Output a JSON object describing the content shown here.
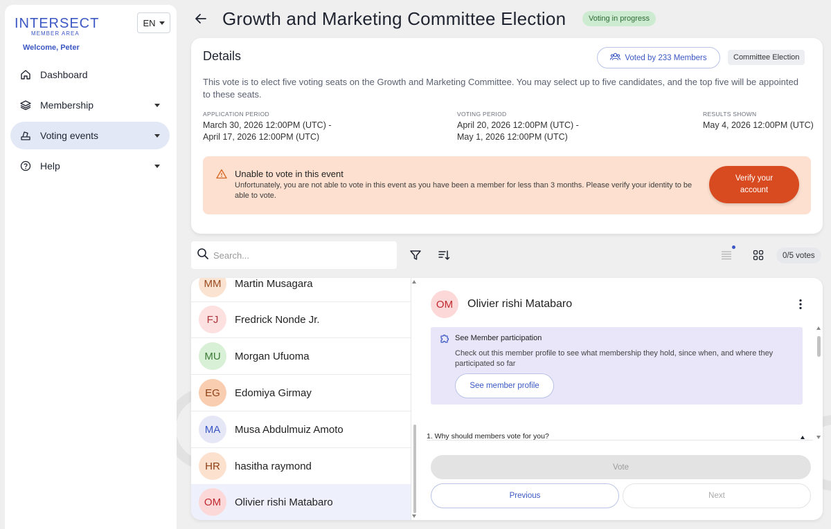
{
  "sidebar": {
    "logo_main": "INTERSECT",
    "logo_sub": "MEMBER AREA",
    "language": "EN",
    "welcome": "Welcome, Peter",
    "items": [
      {
        "label": "Dashboard",
        "icon": "home-icon"
      },
      {
        "label": "Membership",
        "icon": "layers-icon"
      },
      {
        "label": "Voting events",
        "icon": "ballot-icon",
        "active": true
      },
      {
        "label": "Help",
        "icon": "help-icon"
      }
    ]
  },
  "header": {
    "title": "Growth and Marketing Committee Election",
    "status": "Voting in progress"
  },
  "details": {
    "heading": "Details",
    "voted_by": "Voted by 233 Members",
    "type": "Committee Election",
    "description": "This vote is to elect five voting seats on the Growth and Marketing Committee. You may select up to five candidates, and the top five will be appointed to these seats.",
    "application": {
      "label": "APPLICATION PERIOD",
      "line1": "March 30, 2026 12:00PM (UTC) -",
      "line2": "April 17, 2026 12:00PM (UTC)"
    },
    "voting": {
      "label": "VOTING PERIOD",
      "line1": "April 20, 2026 12:00PM (UTC) -",
      "line2": "May 1, 2026 12:00PM (UTC)"
    },
    "results": {
      "label": "RESULTS SHOWN",
      "line1": "May 4, 2026 12:00PM (UTC)"
    },
    "alert": {
      "title": "Unable to vote in this event",
      "body": "Unfortunately, you are not able to vote in this event as you have been a member for less than 3 months. Please verify your identity to be able to vote.",
      "button_line1": "Verify your",
      "button_line2": "account"
    }
  },
  "toolbar": {
    "search_placeholder": "Search...",
    "votes": "0/5 votes"
  },
  "candidates": [
    {
      "initials": "MM",
      "name": "Martin Musagara",
      "bg": "#fbe3d2",
      "fg": "#9a4a1f"
    },
    {
      "initials": "FJ",
      "name": "Fredrick Nonde Jr.",
      "bg": "#fde0e0",
      "fg": "#b0333a"
    },
    {
      "initials": "MU",
      "name": "Morgan Ufuoma",
      "bg": "#d8f0d5",
      "fg": "#3d7a36"
    },
    {
      "initials": "EG",
      "name": "Edomiya Girmay",
      "bg": "#f9cdb0",
      "fg": "#8f3f16"
    },
    {
      "initials": "MA",
      "name": "Musa Abdulmuiz Amoto",
      "bg": "#e5e7f7",
      "fg": "#3b57c4"
    },
    {
      "initials": "HR",
      "name": "hasitha raymond",
      "bg": "#fde1cf",
      "fg": "#8f3f16"
    },
    {
      "initials": "OM",
      "name": "Olivier rishi Matabaro",
      "bg": "#fcd8d8",
      "fg": "#c0282f",
      "selected": true
    }
  ],
  "detail": {
    "initials": "OM",
    "name": "Olivier rishi Matabaro",
    "participation_title": "See Member participation",
    "participation_body": "Check out this member profile to see what membership they hold, since when, and where they participated so far",
    "profile_button": "See member profile",
    "question": "1. Why should members vote for you?",
    "vote_button": "Vote",
    "previous_button": "Previous",
    "next_button": "Next"
  }
}
